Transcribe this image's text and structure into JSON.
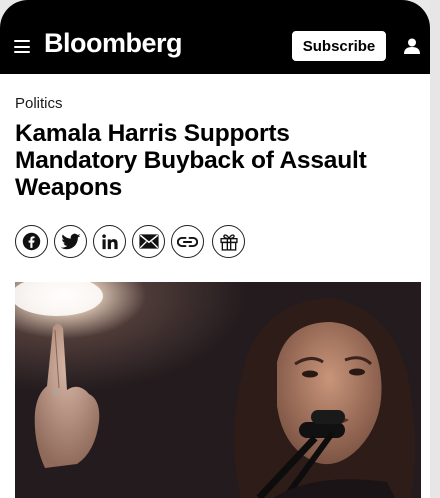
{
  "header": {
    "logo_text": "Bloomberg",
    "subscribe_label": "Subscribe"
  },
  "article": {
    "section": "Politics",
    "headline": "Kamala Harris Supports Mandatory Buyback of Assault Weapons"
  },
  "share_icons": [
    "facebook-icon",
    "twitter-icon",
    "linkedin-icon",
    "email-icon",
    "link-icon",
    "gift-icon"
  ],
  "colors": {
    "header_bg": "#000000",
    "page_bg": "#ffffff",
    "text": "#000000"
  }
}
